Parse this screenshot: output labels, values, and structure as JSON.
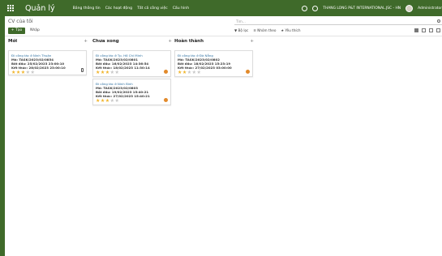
{
  "topbar": {
    "brand": "Quản lý",
    "menu": [
      "Bảng thông tin",
      "Các hoạt động",
      "Tất cả công việc",
      "Cấu hình"
    ],
    "company": "THANG LONG P&T INTERNATIONAL.JSC - HN",
    "user": "Administrator"
  },
  "control": {
    "breadcrumb": "CV của tôi",
    "create_label": "+ Tạo",
    "import_label": "Nhập",
    "search_placeholder": "Tìm...",
    "filter_label": "▼ Bộ lọc",
    "group_label": "≡ Nhóm theo",
    "favorite_label": "★ Yêu thích"
  },
  "columns": [
    {
      "title": "Mới",
      "cards": [
        {
          "title": "Đi công tác ở Ninh Thuận",
          "code": "Mã: TASK/2023/02/0854",
          "start": "Bắt đầu: 25/02/2023 23:00:10",
          "end": "Kết thúc: 28/02/2023 23:00:10",
          "stars": 3
        }
      ]
    },
    {
      "title": "Chưa xong",
      "cards": [
        {
          "title": "Đi công tác ở Tp. Hồ Chí Minh",
          "code": "Mã: TASK/2023/02/0801",
          "start": "Bắt đầu: 16/02/2023 14:36:54",
          "end": "Kết thúc: 18/02/2023 11:30:14",
          "stars": 3
        },
        {
          "title": "Đi công tác ở Ninh Bình",
          "code": "Mã: TASK/2023/02/0803",
          "start": "Bắt đầu: 19/02/2023 15:40:21",
          "end": "Kết thúc: 27/02/2023 15:40:21",
          "stars": 3
        }
      ]
    },
    {
      "title": "Hoàn thành",
      "cards": [
        {
          "title": "Đi công tác ở Đà Nẵng",
          "code": "Mã: TASK/2023/02/0802",
          "start": "Bắt đầu: 18/02/2023 15:23:19",
          "end": "Kết thúc: 27/02/2023 03:00:00",
          "stars": 2
        }
      ]
    }
  ]
}
